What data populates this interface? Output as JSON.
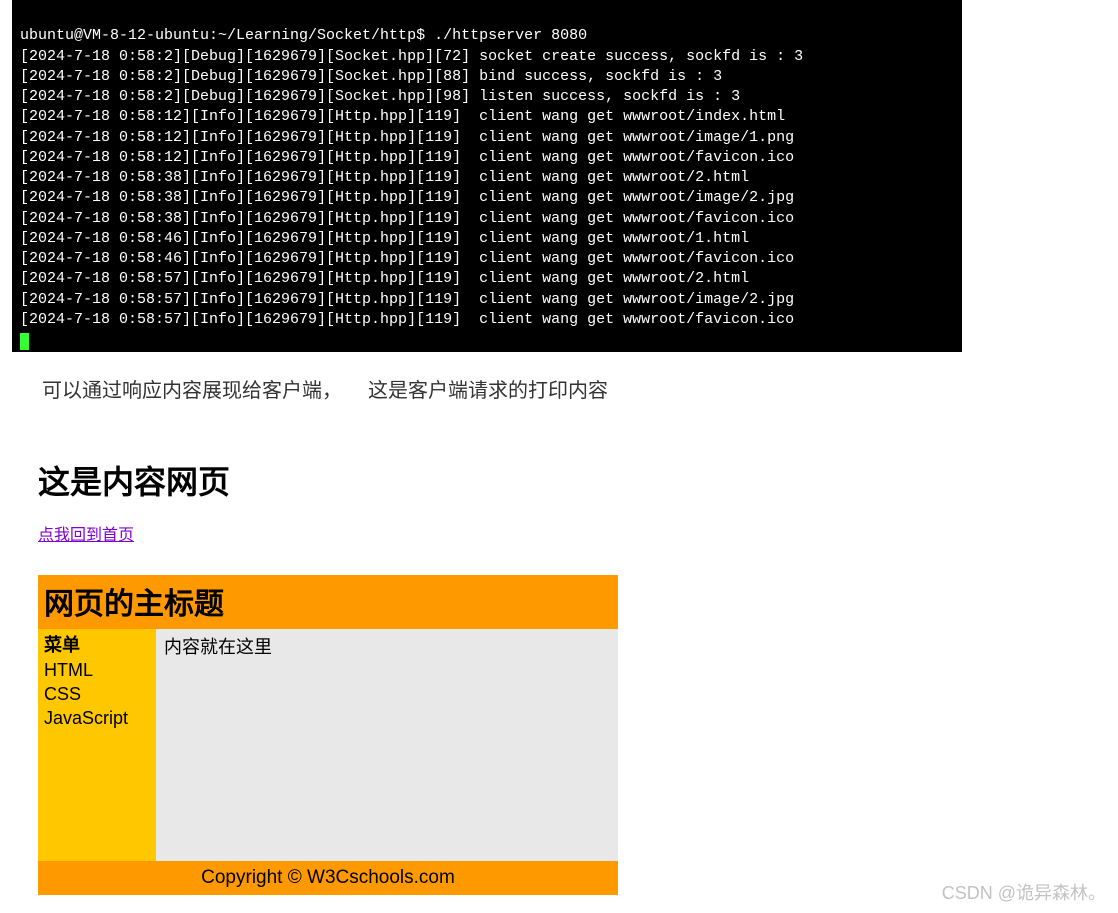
{
  "terminal": {
    "prompt": "ubuntu@VM-8-12-ubuntu:~/Learning/Socket/http$ ./httpserver 8080",
    "lines": [
      "[2024-7-18 0:58:2][Debug][1629679][Socket.hpp][72] socket create success, sockfd is : 3",
      "[2024-7-18 0:58:2][Debug][1629679][Socket.hpp][88] bind success, sockfd is : 3",
      "[2024-7-18 0:58:2][Debug][1629679][Socket.hpp][98] listen success, sockfd is : 3",
      "[2024-7-18 0:58:12][Info][1629679][Http.hpp][119]  client wang get wwwroot/index.html",
      "[2024-7-18 0:58:12][Info][1629679][Http.hpp][119]  client wang get wwwroot/image/1.png",
      "[2024-7-18 0:58:12][Info][1629679][Http.hpp][119]  client wang get wwwroot/favicon.ico",
      "[2024-7-18 0:58:38][Info][1629679][Http.hpp][119]  client wang get wwwroot/2.html",
      "[2024-7-18 0:58:38][Info][1629679][Http.hpp][119]  client wang get wwwroot/image/2.jpg",
      "[2024-7-18 0:58:38][Info][1629679][Http.hpp][119]  client wang get wwwroot/favicon.ico",
      "[2024-7-18 0:58:46][Info][1629679][Http.hpp][119]  client wang get wwwroot/1.html",
      "[2024-7-18 0:58:46][Info][1629679][Http.hpp][119]  client wang get wwwroot/favicon.ico",
      "[2024-7-18 0:58:57][Info][1629679][Http.hpp][119]  client wang get wwwroot/2.html",
      "[2024-7-18 0:58:57][Info][1629679][Http.hpp][119]  client wang get wwwroot/image/2.jpg",
      "[2024-7-18 0:58:57][Info][1629679][Http.hpp][119]  client wang get wwwroot/favicon.ico"
    ]
  },
  "caption": {
    "part1": "可以通过响应内容展现给客户端，",
    "part2": "这是客户端请求的打印内容"
  },
  "page": {
    "heading": "这是内容网页",
    "back_link": "点我回到首页"
  },
  "demo": {
    "title": "网页的主标题",
    "menu_title": "菜单",
    "menu_items": [
      "HTML",
      "CSS",
      "JavaScript"
    ],
    "content": "内容就在这里",
    "footer": "Copyright © W3Cschools.com"
  },
  "watermark": "CSDN @诡异森林。"
}
